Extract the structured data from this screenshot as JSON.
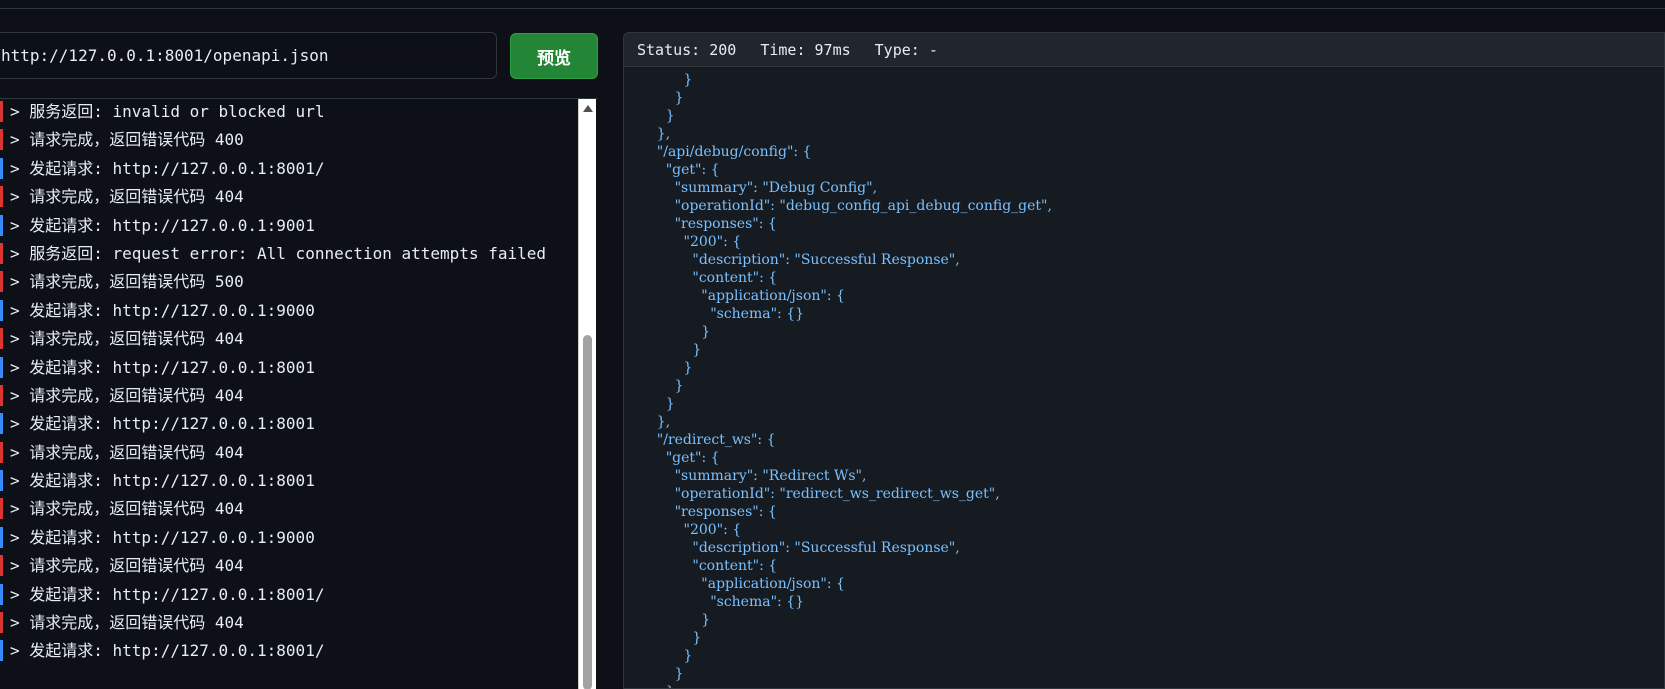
{
  "toolbar": {
    "url_value": "http://127.0.0.1:8001/openapi.json",
    "preview_label": "预览"
  },
  "log": [
    {
      "kind": "err",
      "text": "> 服务返回: invalid or blocked url"
    },
    {
      "kind": "err",
      "text": "> 请求完成，返回错误代码 400"
    },
    {
      "kind": "req",
      "text": "> 发起请求: http://127.0.0.1:8001/"
    },
    {
      "kind": "err",
      "text": "> 请求完成，返回错误代码 404"
    },
    {
      "kind": "req",
      "text": "> 发起请求: http://127.0.0.1:9001"
    },
    {
      "kind": "err",
      "text": "> 服务返回: request error: All connection attempts failed"
    },
    {
      "kind": "err",
      "text": "> 请求完成，返回错误代码 500"
    },
    {
      "kind": "req",
      "text": "> 发起请求: http://127.0.0.1:9000"
    },
    {
      "kind": "err",
      "text": "> 请求完成，返回错误代码 404"
    },
    {
      "kind": "req",
      "text": "> 发起请求: http://127.0.0.1:8001"
    },
    {
      "kind": "err",
      "text": "> 请求完成，返回错误代码 404"
    },
    {
      "kind": "req",
      "text": "> 发起请求: http://127.0.0.1:8001"
    },
    {
      "kind": "err",
      "text": "> 请求完成，返回错误代码 404"
    },
    {
      "kind": "req",
      "text": "> 发起请求: http://127.0.0.1:8001"
    },
    {
      "kind": "err",
      "text": "> 请求完成，返回错误代码 404"
    },
    {
      "kind": "req",
      "text": "> 发起请求: http://127.0.0.1:9000"
    },
    {
      "kind": "err",
      "text": "> 请求完成，返回错误代码 404"
    },
    {
      "kind": "req",
      "text": "> 发起请求: http://127.0.0.1:8001/"
    },
    {
      "kind": "err",
      "text": "> 请求完成，返回错误代码 404"
    },
    {
      "kind": "req",
      "text": "> 发起请求: http://127.0.0.1:8001/"
    }
  ],
  "response": {
    "status": "Status: 200",
    "time": "Time: 97ms",
    "type": "Type: -",
    "body": "          }\n        }\n      }\n    },\n    \"/api/debug/config\": {\n      \"get\": {\n        \"summary\": \"Debug Config\",\n        \"operationId\": \"debug_config_api_debug_config_get\",\n        \"responses\": {\n          \"200\": {\n            \"description\": \"Successful Response\",\n            \"content\": {\n              \"application/json\": {\n                \"schema\": {}\n              }\n            }\n          }\n        }\n      }\n    },\n    \"/redirect_ws\": {\n      \"get\": {\n        \"summary\": \"Redirect Ws\",\n        \"operationId\": \"redirect_ws_redirect_ws_get\",\n        \"responses\": {\n          \"200\": {\n            \"description\": \"Successful Response\",\n            \"content\": {\n              \"application/json\": {\n                \"schema\": {}\n              }\n            }\n          }\n        }\n      }\n    },"
  },
  "colors": {
    "error_marker": "#da3633",
    "request_marker": "#388bfd",
    "button": "#238636",
    "json_text": "#79c0ff"
  }
}
